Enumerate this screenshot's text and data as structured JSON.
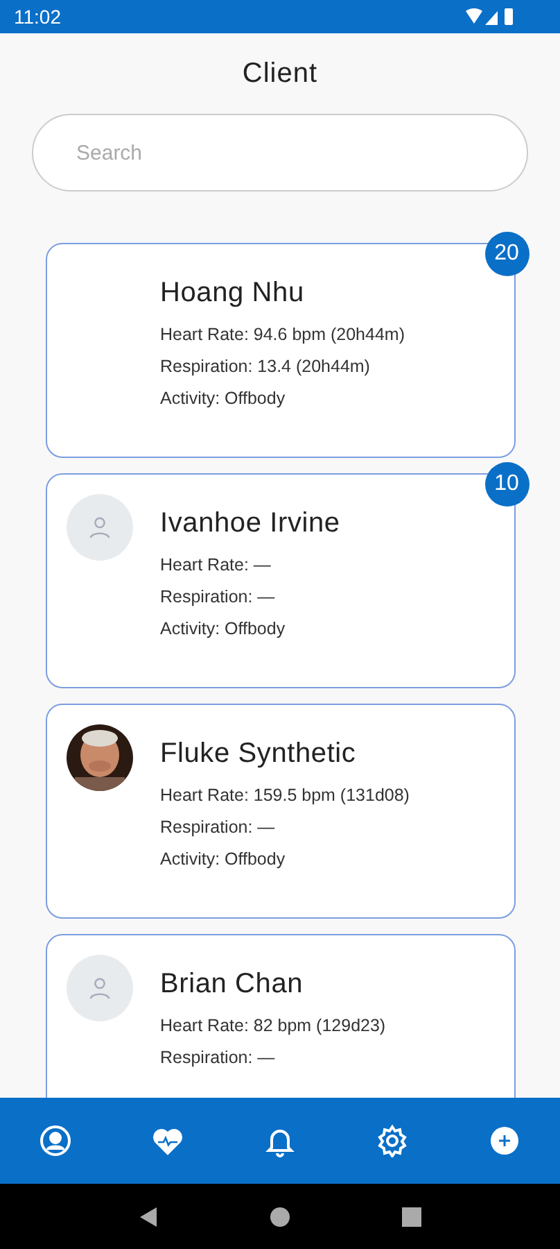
{
  "status_bar": {
    "time": "11:02"
  },
  "title": "Client",
  "search": {
    "placeholder": "Search"
  },
  "clients": [
    {
      "name": "Hoang Nhu",
      "kind": "blank",
      "badge": "20",
      "lines": [
        "Heart Rate: 94.6 bpm (20h44m)",
        "Respiration: 13.4 (20h44m)",
        "Activity: Offbody"
      ]
    },
    {
      "name": "Ivanhoe Irvine",
      "kind": "placeholder",
      "badge": "10",
      "lines": [
        "Heart Rate: —",
        "Respiration: —",
        "Activity: Offbody"
      ]
    },
    {
      "name": "Fluke Synthetic",
      "lines": [
        "Heart Rate: 159.5 bpm (131d08)",
        "Respiration: —",
        "Activity: Offbody"
      ]
    },
    {
      "name": "Brian Chan",
      "kind": "placeholder",
      "lines": [
        "Heart Rate: 82 bpm (129d23)",
        "Respiration: —"
      ]
    }
  ],
  "nav_tabs": [
    {
      "kind": "profile"
    },
    {
      "kind": "heart"
    },
    {
      "kind": "bell"
    },
    {
      "kind": "gear"
    },
    {
      "kind": "add"
    }
  ]
}
